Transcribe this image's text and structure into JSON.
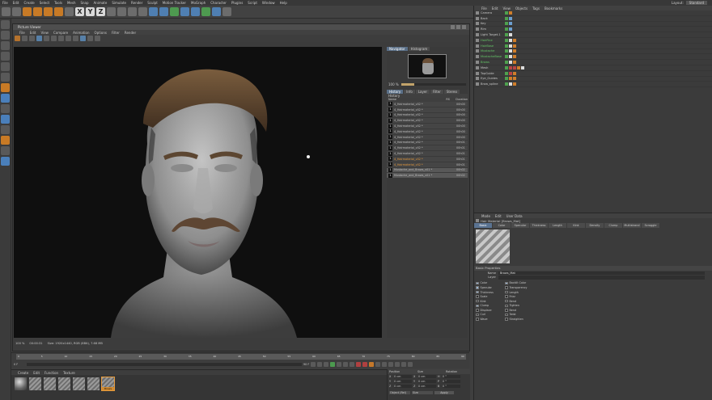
{
  "menubar": {
    "items": [
      "File",
      "Edit",
      "Create",
      "Select",
      "Tools",
      "Mesh",
      "Snap",
      "Animate",
      "Simulate",
      "Render",
      "Sculpt",
      "Motion Tracker",
      "MoGraph",
      "Character",
      "Plugins",
      "Script",
      "Window",
      "Help"
    ],
    "layout_label": "Layout:",
    "layout_value": "Standard"
  },
  "picture_viewer": {
    "title": "Picture Viewer",
    "menu": [
      "File",
      "Edit",
      "View",
      "Compare",
      "Animation",
      "Options",
      "Filter",
      "Render"
    ],
    "nav_tabs": [
      "Navigator",
      "Histogram"
    ],
    "zoom": "100 %",
    "tabs": [
      "History",
      "Info",
      "Layer",
      "Filter",
      "Stereo"
    ],
    "history_header": "History",
    "history_cols": [
      "Name",
      "RS",
      "Duration"
    ],
    "history": [
      {
        "n": "1",
        "name": "4_Hairmaterial_v02 *",
        "dur": "00h00"
      },
      {
        "n": "1",
        "name": "4_Hairmaterial_v02 *",
        "dur": "00h00"
      },
      {
        "n": "1",
        "name": "4_Hairmaterial_v02 *",
        "dur": "00h00"
      },
      {
        "n": "1",
        "name": "4_Hairmaterial_v02 *",
        "dur": "00h00"
      },
      {
        "n": "1",
        "name": "4_Hairmaterial_v02 *",
        "dur": "00h00"
      },
      {
        "n": "1",
        "name": "4_Hairmaterial_v02 *",
        "dur": "00h00"
      },
      {
        "n": "1",
        "name": "4_Hairmaterial_v02 *",
        "dur": "00h00"
      },
      {
        "n": "1",
        "name": "4_Hairmaterial_v02 *",
        "dur": "00h01"
      },
      {
        "n": "1",
        "name": "4_Hairmaterial_v02 *",
        "dur": "00h01"
      },
      {
        "n": "1",
        "name": "4_Hairmaterial_v02 *",
        "dur": "00h01"
      },
      {
        "n": "1",
        "name": "4_Hairmaterial_v02 *",
        "dur": "00h01"
      },
      {
        "n": "1",
        "name": "4_Hairmaterial_v02 *",
        "dur": "00h01"
      },
      {
        "n": "1",
        "name": "Mustache_and_Brows_v01 *",
        "dur": "00h02"
      },
      {
        "n": "1",
        "name": "Mustache_and_Brows_v01 *",
        "dur": "00h02"
      }
    ],
    "status": {
      "zoom": "100 %",
      "time": "00:00:31",
      "size": "Size: 1920x1440, RGB (8Bit), 7.68 MB"
    }
  },
  "timeline": {
    "ticks": [
      "0",
      "5",
      "10",
      "15",
      "20",
      "25",
      "30",
      "35",
      "40",
      "45",
      "50",
      "55",
      "60",
      "65",
      "70",
      "75",
      "80",
      "85",
      "90"
    ],
    "start": "0 F",
    "frame": "0 F",
    "end": "90 F"
  },
  "materials": {
    "menu": [
      "Create",
      "Edit",
      "Function",
      "Texture"
    ],
    "selected_label": "Brows"
  },
  "coordinates": {
    "headers": [
      "Position",
      "Size",
      "Rotation"
    ],
    "rows": [
      {
        "a": "X",
        "av": "0 cm",
        "b": "X",
        "bv": "0 cm",
        "c": "H",
        "cv": "0 °"
      },
      {
        "a": "Y",
        "av": "0 cm",
        "b": "Y",
        "bv": "0 cm",
        "c": "P",
        "cv": "0 °"
      },
      {
        "a": "Z",
        "av": "0 cm",
        "b": "Z",
        "bv": "0 cm",
        "c": "B",
        "cv": "0 °"
      }
    ],
    "mode": "Object (Rel)",
    "size_mode": "Size",
    "apply": "Apply"
  },
  "object_manager": {
    "menu": [
      "File",
      "Edit",
      "View",
      "Objects",
      "Tags",
      "Bookmarks"
    ],
    "objects": [
      {
        "name": "Camera",
        "green": false
      },
      {
        "name": "Back",
        "green": false
      },
      {
        "name": "Key",
        "green": false
      },
      {
        "name": "Rim",
        "green": false
      },
      {
        "name": "Light Target.1",
        "green": false
      },
      {
        "name": "HairFine",
        "green": true
      },
      {
        "name": "HairBase",
        "green": true
      },
      {
        "name": "Mustache",
        "green": true
      },
      {
        "name": "MustacheBase",
        "green": true
      },
      {
        "name": "Brows",
        "green": true
      },
      {
        "name": "Mesh",
        "green": false
      },
      {
        "name": "TopGuide",
        "green": false
      },
      {
        "name": "Eye_Guides",
        "green": false
      },
      {
        "name": "Brow_spline",
        "green": false
      }
    ]
  },
  "attributes": {
    "menu": [
      "Mode",
      "Edit",
      "User Data"
    ],
    "title": "Hair Material [Brows_Mat]",
    "tabs": [
      "Basic",
      "Color",
      "Specular",
      "Thickness",
      "Length",
      "Kink",
      "Density",
      "Clump",
      "Multistrand",
      "Scraggle"
    ],
    "section": "Basic Properties",
    "name_label": "Name",
    "name_value": "Brows_Mat",
    "layer_label": "Layer",
    "checks_left": [
      {
        "label": "Color",
        "on": true
      },
      {
        "label": "Specular",
        "on": true
      },
      {
        "label": "Thickness",
        "on": true
      },
      {
        "label": "Scale",
        "on": false
      },
      {
        "label": "Kink",
        "on": false
      },
      {
        "label": "Clump",
        "on": true
      },
      {
        "label": "Displace",
        "on": false
      },
      {
        "label": "Curl",
        "on": false
      },
      {
        "label": "Wave",
        "on": false
      }
    ],
    "checks_right": [
      {
        "label": "Backlit Color",
        "on": true
      },
      {
        "label": "Transparency",
        "on": false
      },
      {
        "label": "Length",
        "on": false
      },
      {
        "label": "Frizz",
        "on": false
      },
      {
        "label": "Bend",
        "on": false
      },
      {
        "label": "Tighten",
        "on": false
      },
      {
        "label": "Bend",
        "on": false
      },
      {
        "label": "Twist",
        "on": false
      },
      {
        "label": "Straighten",
        "on": false
      }
    ]
  },
  "colors": {
    "accent": "#c87a25",
    "selection": "#5a7392",
    "valid": "#4ea14e"
  }
}
